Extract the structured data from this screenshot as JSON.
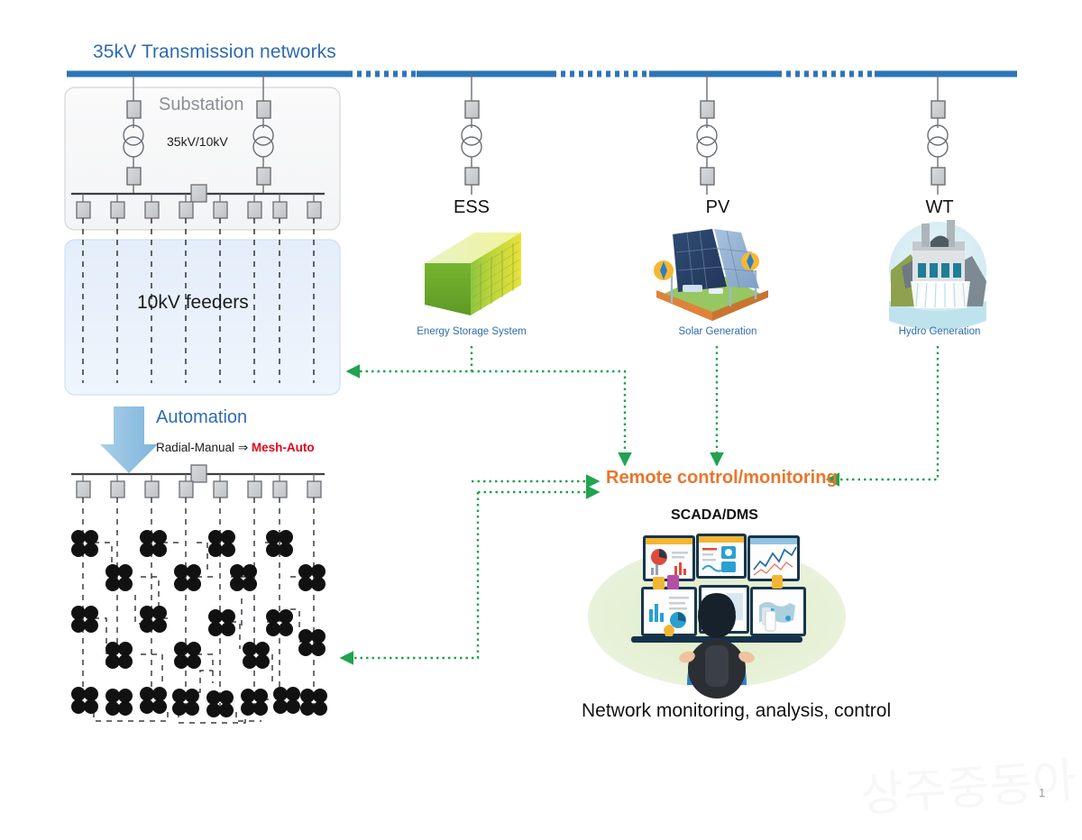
{
  "diagram": {
    "title": "35kV Transmission networks",
    "page_number": "1",
    "watermark": "상주중동아"
  },
  "substation": {
    "label": "Substation",
    "voltage_ratio": "35kV/10kV",
    "transformer_count": 2,
    "feeder_breaker_count": 8,
    "bus_tie_label": "bus-tie"
  },
  "feeders": {
    "label": "10kV feeders",
    "count": 8
  },
  "automation": {
    "label": "Automation",
    "transition_from": "Radial-Manual",
    "transition_arrow": "⇒",
    "transition_to": "Mesh-Auto"
  },
  "sources": [
    {
      "id": "ess",
      "name": "ESS",
      "caption": "Energy Storage System",
      "icon": "battery-rack-icon"
    },
    {
      "id": "pv",
      "name": "PV",
      "caption": "Solar Generation",
      "icon": "solar-panel-icon"
    },
    {
      "id": "wt",
      "name": "WT",
      "caption": "Hydro Generation",
      "icon": "hydro-dam-icon"
    }
  ],
  "control": {
    "remote_label": "Remote control/monitoring",
    "scada_label": "SCADA/DMS",
    "footer_label": "Network monitoring, analysis, control",
    "icon": "control-room-operator-icon"
  },
  "colors": {
    "transmission_line": "#2e75b6",
    "title_blue": "#2e6bb0",
    "caption_blue": "#2e6bb0",
    "remote_orange": "#e8762c",
    "arrow_green": "#21a350",
    "mesh_auto_red": "#e2071b",
    "equipment_gray": "#c8cacc",
    "substation_bg": "#f7f7f8",
    "feeders_bg": "#e8f1fa"
  }
}
